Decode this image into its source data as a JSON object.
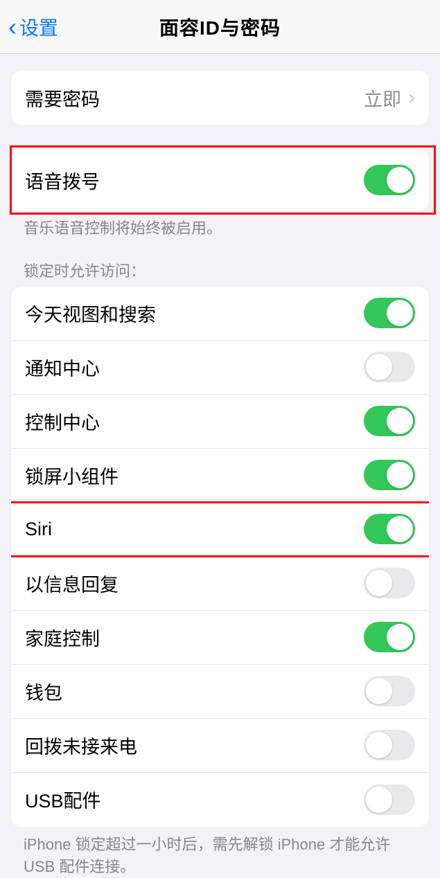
{
  "nav": {
    "back_label": "设置",
    "title": "面容ID与密码"
  },
  "require_passcode": {
    "label": "需要密码",
    "value": "立即"
  },
  "voice_dial": {
    "label": "语音拨号",
    "footer": "音乐语音控制将始终被启用。"
  },
  "allow_access_header": "锁定时允许访问：",
  "allow_access": {
    "today": "今天视图和搜索",
    "notification": "通知中心",
    "control": "控制中心",
    "widgets": "锁屏小组件",
    "siri": "Siri",
    "reply": "以信息回复",
    "home": "家庭控制",
    "wallet": "钱包",
    "callback": "回拨未接来电",
    "usb": "USB配件"
  },
  "usb_footer": "iPhone 锁定超过一小时后，需先解锁 iPhone 才能允许 USB 配件连接。"
}
